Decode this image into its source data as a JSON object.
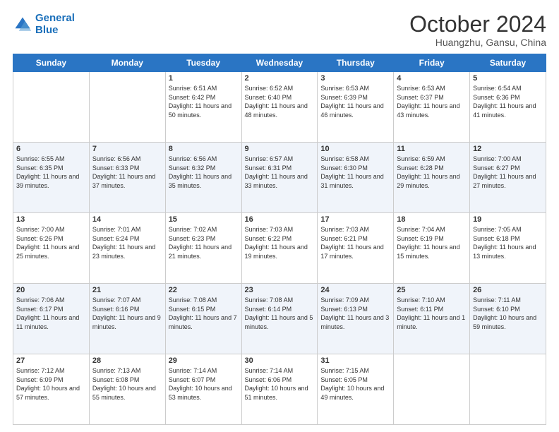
{
  "header": {
    "logo_line1": "General",
    "logo_line2": "Blue",
    "month_title": "October 2024",
    "subtitle": "Huangzhu, Gansu, China"
  },
  "days_of_week": [
    "Sunday",
    "Monday",
    "Tuesday",
    "Wednesday",
    "Thursday",
    "Friday",
    "Saturday"
  ],
  "weeks": [
    [
      {
        "day": "",
        "sunrise": "",
        "sunset": "",
        "daylight": ""
      },
      {
        "day": "",
        "sunrise": "",
        "sunset": "",
        "daylight": ""
      },
      {
        "day": "1",
        "sunrise": "Sunrise: 6:51 AM",
        "sunset": "Sunset: 6:42 PM",
        "daylight": "Daylight: 11 hours and 50 minutes."
      },
      {
        "day": "2",
        "sunrise": "Sunrise: 6:52 AM",
        "sunset": "Sunset: 6:40 PM",
        "daylight": "Daylight: 11 hours and 48 minutes."
      },
      {
        "day": "3",
        "sunrise": "Sunrise: 6:53 AM",
        "sunset": "Sunset: 6:39 PM",
        "daylight": "Daylight: 11 hours and 46 minutes."
      },
      {
        "day": "4",
        "sunrise": "Sunrise: 6:53 AM",
        "sunset": "Sunset: 6:37 PM",
        "daylight": "Daylight: 11 hours and 43 minutes."
      },
      {
        "day": "5",
        "sunrise": "Sunrise: 6:54 AM",
        "sunset": "Sunset: 6:36 PM",
        "daylight": "Daylight: 11 hours and 41 minutes."
      }
    ],
    [
      {
        "day": "6",
        "sunrise": "Sunrise: 6:55 AM",
        "sunset": "Sunset: 6:35 PM",
        "daylight": "Daylight: 11 hours and 39 minutes."
      },
      {
        "day": "7",
        "sunrise": "Sunrise: 6:56 AM",
        "sunset": "Sunset: 6:33 PM",
        "daylight": "Daylight: 11 hours and 37 minutes."
      },
      {
        "day": "8",
        "sunrise": "Sunrise: 6:56 AM",
        "sunset": "Sunset: 6:32 PM",
        "daylight": "Daylight: 11 hours and 35 minutes."
      },
      {
        "day": "9",
        "sunrise": "Sunrise: 6:57 AM",
        "sunset": "Sunset: 6:31 PM",
        "daylight": "Daylight: 11 hours and 33 minutes."
      },
      {
        "day": "10",
        "sunrise": "Sunrise: 6:58 AM",
        "sunset": "Sunset: 6:30 PM",
        "daylight": "Daylight: 11 hours and 31 minutes."
      },
      {
        "day": "11",
        "sunrise": "Sunrise: 6:59 AM",
        "sunset": "Sunset: 6:28 PM",
        "daylight": "Daylight: 11 hours and 29 minutes."
      },
      {
        "day": "12",
        "sunrise": "Sunrise: 7:00 AM",
        "sunset": "Sunset: 6:27 PM",
        "daylight": "Daylight: 11 hours and 27 minutes."
      }
    ],
    [
      {
        "day": "13",
        "sunrise": "Sunrise: 7:00 AM",
        "sunset": "Sunset: 6:26 PM",
        "daylight": "Daylight: 11 hours and 25 minutes."
      },
      {
        "day": "14",
        "sunrise": "Sunrise: 7:01 AM",
        "sunset": "Sunset: 6:24 PM",
        "daylight": "Daylight: 11 hours and 23 minutes."
      },
      {
        "day": "15",
        "sunrise": "Sunrise: 7:02 AM",
        "sunset": "Sunset: 6:23 PM",
        "daylight": "Daylight: 11 hours and 21 minutes."
      },
      {
        "day": "16",
        "sunrise": "Sunrise: 7:03 AM",
        "sunset": "Sunset: 6:22 PM",
        "daylight": "Daylight: 11 hours and 19 minutes."
      },
      {
        "day": "17",
        "sunrise": "Sunrise: 7:03 AM",
        "sunset": "Sunset: 6:21 PM",
        "daylight": "Daylight: 11 hours and 17 minutes."
      },
      {
        "day": "18",
        "sunrise": "Sunrise: 7:04 AM",
        "sunset": "Sunset: 6:19 PM",
        "daylight": "Daylight: 11 hours and 15 minutes."
      },
      {
        "day": "19",
        "sunrise": "Sunrise: 7:05 AM",
        "sunset": "Sunset: 6:18 PM",
        "daylight": "Daylight: 11 hours and 13 minutes."
      }
    ],
    [
      {
        "day": "20",
        "sunrise": "Sunrise: 7:06 AM",
        "sunset": "Sunset: 6:17 PM",
        "daylight": "Daylight: 11 hours and 11 minutes."
      },
      {
        "day": "21",
        "sunrise": "Sunrise: 7:07 AM",
        "sunset": "Sunset: 6:16 PM",
        "daylight": "Daylight: 11 hours and 9 minutes."
      },
      {
        "day": "22",
        "sunrise": "Sunrise: 7:08 AM",
        "sunset": "Sunset: 6:15 PM",
        "daylight": "Daylight: 11 hours and 7 minutes."
      },
      {
        "day": "23",
        "sunrise": "Sunrise: 7:08 AM",
        "sunset": "Sunset: 6:14 PM",
        "daylight": "Daylight: 11 hours and 5 minutes."
      },
      {
        "day": "24",
        "sunrise": "Sunrise: 7:09 AM",
        "sunset": "Sunset: 6:13 PM",
        "daylight": "Daylight: 11 hours and 3 minutes."
      },
      {
        "day": "25",
        "sunrise": "Sunrise: 7:10 AM",
        "sunset": "Sunset: 6:11 PM",
        "daylight": "Daylight: 11 hours and 1 minute."
      },
      {
        "day": "26",
        "sunrise": "Sunrise: 7:11 AM",
        "sunset": "Sunset: 6:10 PM",
        "daylight": "Daylight: 10 hours and 59 minutes."
      }
    ],
    [
      {
        "day": "27",
        "sunrise": "Sunrise: 7:12 AM",
        "sunset": "Sunset: 6:09 PM",
        "daylight": "Daylight: 10 hours and 57 minutes."
      },
      {
        "day": "28",
        "sunrise": "Sunrise: 7:13 AM",
        "sunset": "Sunset: 6:08 PM",
        "daylight": "Daylight: 10 hours and 55 minutes."
      },
      {
        "day": "29",
        "sunrise": "Sunrise: 7:14 AM",
        "sunset": "Sunset: 6:07 PM",
        "daylight": "Daylight: 10 hours and 53 minutes."
      },
      {
        "day": "30",
        "sunrise": "Sunrise: 7:14 AM",
        "sunset": "Sunset: 6:06 PM",
        "daylight": "Daylight: 10 hours and 51 minutes."
      },
      {
        "day": "31",
        "sunrise": "Sunrise: 7:15 AM",
        "sunset": "Sunset: 6:05 PM",
        "daylight": "Daylight: 10 hours and 49 minutes."
      },
      {
        "day": "",
        "sunrise": "",
        "sunset": "",
        "daylight": ""
      },
      {
        "day": "",
        "sunrise": "",
        "sunset": "",
        "daylight": ""
      }
    ]
  ]
}
